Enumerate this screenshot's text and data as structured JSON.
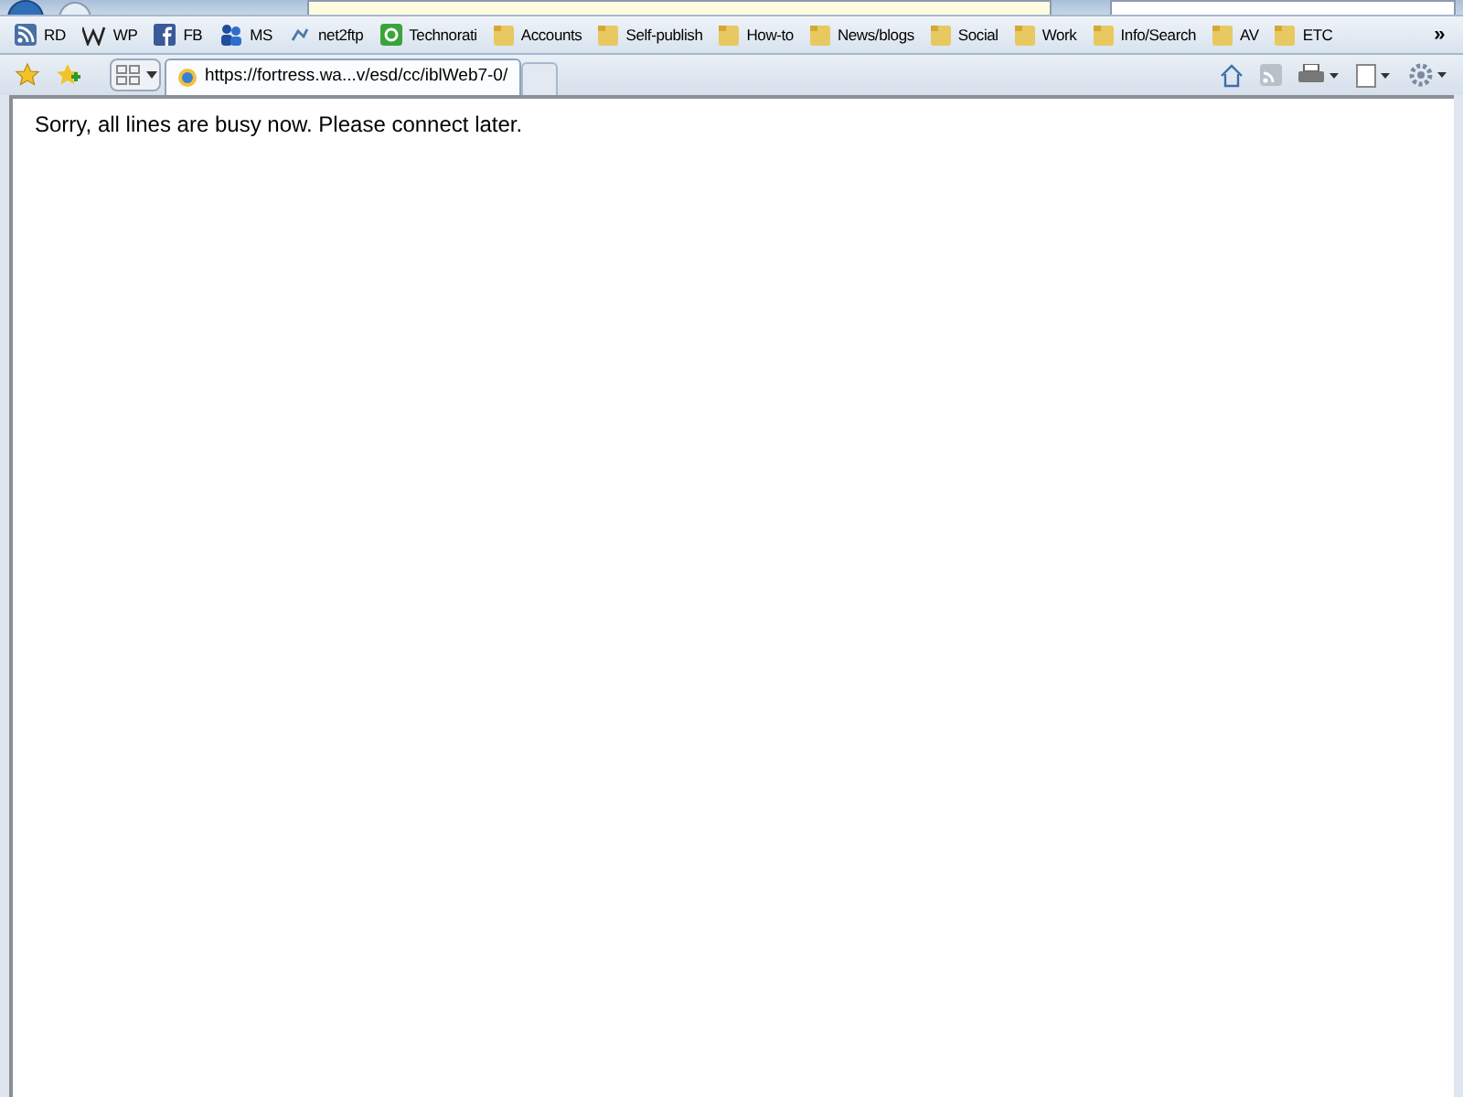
{
  "favorites_bar": {
    "items": [
      {
        "label": "RD",
        "kind": "feed"
      },
      {
        "label": "WP",
        "kind": "wiki"
      },
      {
        "label": "FB",
        "kind": "facebook"
      },
      {
        "label": "MS",
        "kind": "ms"
      },
      {
        "label": "net2ftp",
        "kind": "ftp"
      },
      {
        "label": "Technorati",
        "kind": "technorati"
      },
      {
        "label": "Accounts",
        "kind": "folder"
      },
      {
        "label": "Self-publish",
        "kind": "folder"
      },
      {
        "label": "How-to",
        "kind": "folder"
      },
      {
        "label": "News/blogs",
        "kind": "folder"
      },
      {
        "label": "Social",
        "kind": "folder"
      },
      {
        "label": "Work",
        "kind": "folder"
      },
      {
        "label": "Info/Search",
        "kind": "folder"
      },
      {
        "label": "AV",
        "kind": "folder"
      },
      {
        "label": "ETC",
        "kind": "folder"
      }
    ],
    "overflow": "»"
  },
  "tabs": [
    {
      "label": "https://fortress.wa...v/esd/cc/iblWeb7-0/",
      "selected": true
    },
    {
      "selected": false
    }
  ],
  "page": {
    "message": "Sorry, all lines are busy now. Please connect later."
  }
}
